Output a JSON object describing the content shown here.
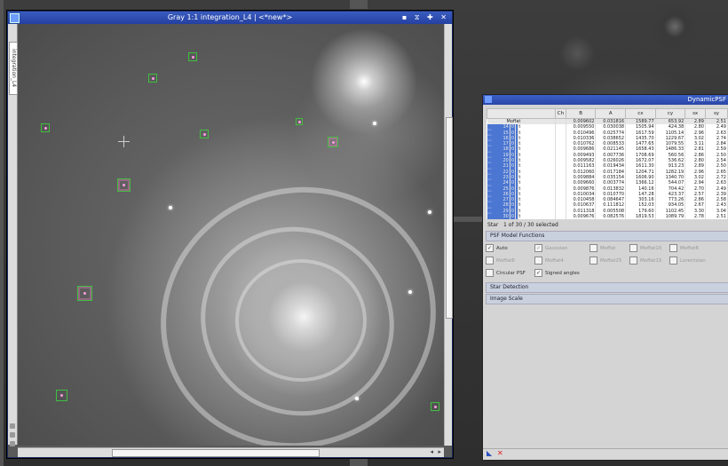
{
  "image_window": {
    "title": "Gray 1:1 integration_L4 | <*new*>",
    "side_tab_label": "integration_L4",
    "title_controls": "▪ ⧖ ✚ ✕"
  },
  "psf": {
    "title": "DynamicPSF",
    "columns": [
      "",
      "Ch",
      "B",
      "A",
      "cx",
      "cy",
      "sx",
      "sy"
    ],
    "rows": [
      {
        "star": "",
        "func": "Moffat",
        "ch": "",
        "b": "0.009602",
        "a": "0.031816",
        "cx": "1589.77",
        "cy": "653.92",
        "sx": "2.89",
        "sy": "2.51"
      },
      {
        "star": "14",
        "func": "Moffat",
        "ch": "0",
        "b": "0.009550",
        "a": "0.030038",
        "cx": "1505.94",
        "cy": "424.38",
        "sx": "2.80",
        "sy": "2.49"
      },
      {
        "star": "15",
        "func": "Moffat",
        "ch": "0",
        "b": "0.010496",
        "a": "0.025774",
        "cx": "1617.59",
        "cy": "1105.14",
        "sx": "2.96",
        "sy": "2.63"
      },
      {
        "star": "16",
        "func": "Moffat",
        "ch": "0",
        "b": "0.010336",
        "a": "0.038652",
        "cx": "1435.70",
        "cy": "1229.67",
        "sx": "3.02",
        "sy": "2.74"
      },
      {
        "star": "17",
        "func": "Moffat",
        "ch": "0",
        "b": "0.010762",
        "a": "0.008533",
        "cx": "1477.65",
        "cy": "1079.55",
        "sx": "3.11",
        "sy": "2.84"
      },
      {
        "star": "18",
        "func": "Moffat",
        "ch": "0",
        "b": "0.009686",
        "a": "0.021145",
        "cx": "1658.43",
        "cy": "1486.33",
        "sx": "2.81",
        "sy": "2.59"
      },
      {
        "star": "19",
        "func": "Moffat",
        "ch": "0",
        "b": "0.009493",
        "a": "0.007736",
        "cx": "1708.69",
        "cy": "560.56",
        "sx": "2.86",
        "sy": "2.50"
      },
      {
        "star": "20",
        "func": "Moffat",
        "ch": "0",
        "b": "0.009582",
        "a": "0.026026",
        "cx": "1672.07",
        "cy": "536.62",
        "sx": "2.80",
        "sy": "2.54"
      },
      {
        "star": "21",
        "func": "Moffat",
        "ch": "0",
        "b": "0.011163",
        "a": "0.019434",
        "cx": "1611.30",
        "cy": "913.23",
        "sx": "2.89",
        "sy": "2.50"
      },
      {
        "star": "22",
        "func": "Moffat",
        "ch": "0",
        "b": "0.012060",
        "a": "0.017184",
        "cx": "1204.71",
        "cy": "1282.19",
        "sx": "2.96",
        "sy": "2.65"
      },
      {
        "star": "23",
        "func": "Moffat",
        "ch": "0",
        "b": "0.009884",
        "a": "0.035154",
        "cx": "1606.90",
        "cy": "1340.70",
        "sx": "3.02",
        "sy": "2.72"
      },
      {
        "star": "24",
        "func": "Moffat",
        "ch": "0",
        "b": "0.009660",
        "a": "0.003774",
        "cx": "1366.12",
        "cy": "544.07",
        "sx": "2.94",
        "sy": "2.63"
      },
      {
        "star": "25",
        "func": "Moffat",
        "ch": "0",
        "b": "0.009876",
        "a": "0.013832",
        "cx": "140.16",
        "cy": "704.42",
        "sx": "2.70",
        "sy": "2.49"
      },
      {
        "star": "26",
        "func": "Moffat",
        "ch": "0",
        "b": "0.010034",
        "a": "0.010770",
        "cx": "147.28",
        "cy": "423.37",
        "sx": "2.57",
        "sy": "2.39"
      },
      {
        "star": "27",
        "func": "Moffat",
        "ch": "0",
        "b": "0.010458",
        "a": "0.084647",
        "cx": "303.16",
        "cy": "773.26",
        "sx": "2.86",
        "sy": "2.58"
      },
      {
        "star": "28",
        "func": "Moffat",
        "ch": "0",
        "b": "0.010637",
        "a": "0.111812",
        "cx": "152.03",
        "cy": "934.05",
        "sx": "2.67",
        "sy": "2.43"
      },
      {
        "star": "29",
        "func": "Moffat",
        "ch": "0",
        "b": "0.011318",
        "a": "0.005508",
        "cx": "179.60",
        "cy": "1102.45",
        "sx": "3.30",
        "sy": "3.04"
      },
      {
        "star": "30",
        "func": "Moffat",
        "ch": "0",
        "b": "0.009676",
        "a": "0.082576",
        "cx": "1819.53",
        "cy": "1089.79",
        "sx": "2.78",
        "sy": "2.51"
      }
    ],
    "star_label": "Star",
    "star_index": "1",
    "star_of": "of",
    "star_count": "30 / 30 selected",
    "sections": {
      "psf_model": "PSF Model Functions",
      "star_detection": "Star Detection",
      "image_scale": "Image Scale"
    },
    "model_options": [
      {
        "label": "Auto",
        "checked": true,
        "enabled": true
      },
      {
        "label": "Gaussian",
        "checked": true,
        "enabled": false
      },
      {
        "label": "Moffat",
        "checked": false,
        "enabled": false
      },
      {
        "label": "Moffat10",
        "checked": false,
        "enabled": false
      },
      {
        "label": "Moffat8",
        "checked": false,
        "enabled": false
      },
      {
        "label": "Moffat6",
        "checked": false,
        "enabled": false
      },
      {
        "label": "Moffat4",
        "checked": false,
        "enabled": false
      },
      {
        "label": "Moffat25",
        "checked": false,
        "enabled": false
      },
      {
        "label": "Moffat15",
        "checked": false,
        "enabled": false
      },
      {
        "label": "Lorentzian",
        "checked": false,
        "enabled": false
      },
      {
        "label": "Circular PSF",
        "checked": false,
        "enabled": true
      },
      {
        "label": "Signed angles",
        "checked": true,
        "enabled": true
      }
    ]
  }
}
